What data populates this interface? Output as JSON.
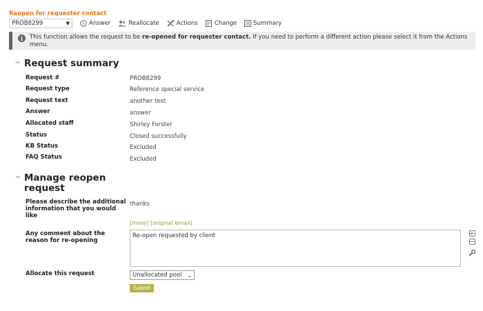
{
  "page": {
    "title": "Reopen for requester contact"
  },
  "toolbar": {
    "request_id": "PROB8299",
    "answer": "Answer",
    "reallocate": "Reallocate",
    "actions": "Actions",
    "change": "Change",
    "summary": "Summary"
  },
  "info": {
    "text_before": "This function allows the request to be ",
    "text_bold": "re-opened for requester contact.",
    "text_after": " If you need to perform a different action please select it from the Actions menu."
  },
  "summary": {
    "title": "Request summary",
    "rows": [
      {
        "label": "Request #",
        "value": "PROB8299"
      },
      {
        "label": "Request type",
        "value": "Reference special service"
      },
      {
        "label": "Request text",
        "value": "another test"
      },
      {
        "label": "Answer",
        "value": "answer"
      },
      {
        "label": "Allocated staff",
        "value": "Shirley Forster"
      },
      {
        "label": "Status",
        "value": "Closed successfully"
      },
      {
        "label": "KB Status",
        "value": "Excluded"
      },
      {
        "label": "FAQ Status",
        "value": "Excluded"
      }
    ]
  },
  "reopen": {
    "title": "Manage reopen request",
    "describe_label": "Please describe the additional information that you would like",
    "describe_value": "thanks",
    "more_link": "[more]",
    "original_link": "[original email]",
    "comment_label": "Any comment about the reason for re-opening",
    "comment_value": "Re-open requested by client",
    "allocate_label": "Allocate this request",
    "allocate_value": "Unallocated pool",
    "submit": "Submit"
  },
  "colors": {
    "title": "#e07b1a",
    "submit": "#b3b34a",
    "links": "#999944"
  }
}
